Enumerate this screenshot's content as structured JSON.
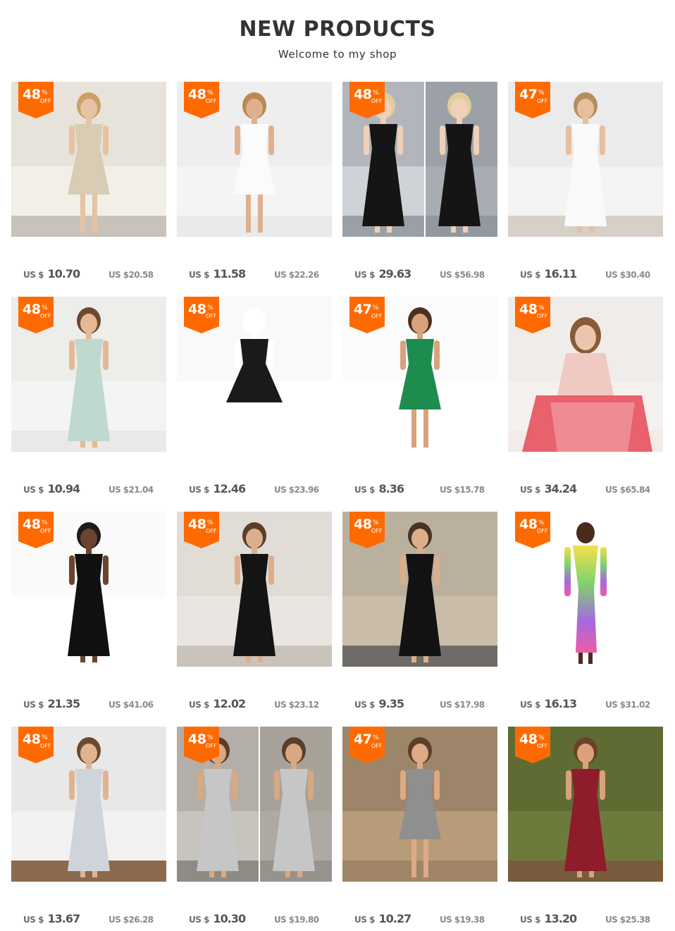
{
  "header": {
    "title": "NEW PRODUCTS",
    "subtitle": "Welcome to my shop"
  },
  "colors": {
    "badge": "#ff6a00",
    "text": "#333333",
    "price": "#555555",
    "old_price": "#8a8a8a"
  },
  "currency_prefix": "US $",
  "badge_symbol": "%",
  "badge_off": "OFF",
  "products": [
    {
      "discount": "48",
      "price": "10.70",
      "old_price": "US $20.58",
      "image": "beige-button-dress"
    },
    {
      "discount": "48",
      "price": "11.58",
      "old_price": "US $22.26",
      "image": "white-lace-offshoulder-dress"
    },
    {
      "discount": "48",
      "price": "29.63",
      "old_price": "US $56.98",
      "image": "black-pleated-dress"
    },
    {
      "discount": "47",
      "price": "16.11",
      "old_price": "US $30.40",
      "image": "white-lace-maxi-dress"
    },
    {
      "discount": "48",
      "price": "10.94",
      "old_price": "US $21.04",
      "image": "mint-button-dress"
    },
    {
      "discount": "48",
      "price": "12.46",
      "old_price": "US $23.96",
      "image": "black-floral-dress"
    },
    {
      "discount": "47",
      "price": "8.36",
      "old_price": "US $15.78",
      "image": "green-polka-dress"
    },
    {
      "discount": "48",
      "price": "34.24",
      "old_price": "US $65.84",
      "image": "pink-red-ruffle-dress"
    },
    {
      "discount": "48",
      "price": "21.35",
      "old_price": "US $41.06",
      "image": "black-ruffle-sleeve-dress"
    },
    {
      "discount": "48",
      "price": "12.02",
      "old_price": "US $23.12",
      "image": "black-maxi-dress"
    },
    {
      "discount": "48",
      "price": "9.35",
      "old_price": "US $17.98",
      "image": "black-vneck-maxi"
    },
    {
      "discount": "48",
      "price": "16.13",
      "old_price": "US $31.02",
      "image": "rainbow-bodycon-dress"
    },
    {
      "discount": "48",
      "price": "13.67",
      "old_price": "US $26.28",
      "image": "striped-sleeveless-maxi"
    },
    {
      "discount": "48",
      "price": "10.30",
      "old_price": "US $19.80",
      "image": "grey-black-tshirt-maxi"
    },
    {
      "discount": "47",
      "price": "10.27",
      "old_price": "US $19.38",
      "image": "grey-striped-midi"
    },
    {
      "discount": "48",
      "price": "13.20",
      "old_price": "US $25.38",
      "image": "red-polka-maxi"
    }
  ]
}
